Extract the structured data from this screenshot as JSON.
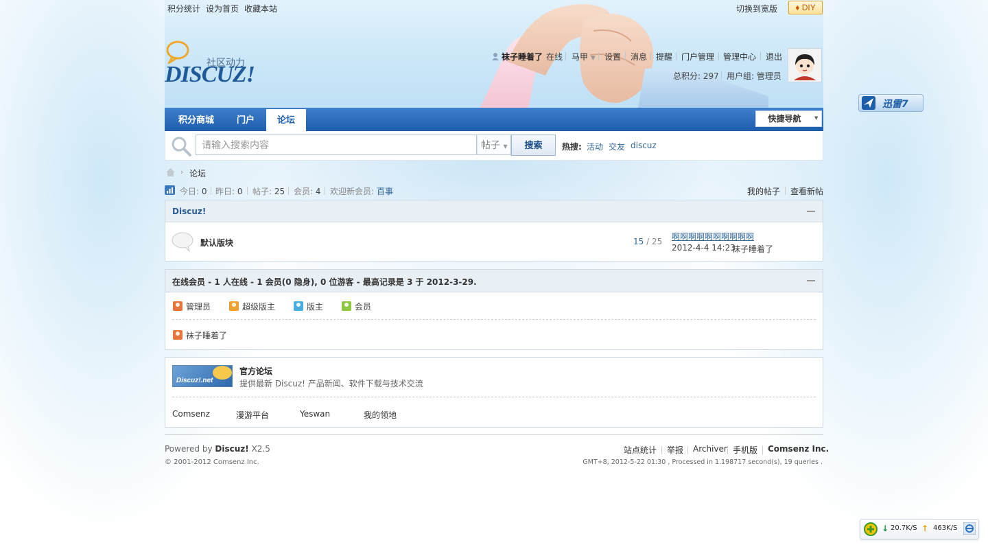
{
  "topbar": {
    "links": [
      "积分统计",
      "设为首页",
      "收藏本站"
    ],
    "wide_switch": "切换到宽版",
    "diy": "DIY"
  },
  "logo": {
    "sub": "社区动力",
    "word": "DISCUZ!"
  },
  "user": {
    "name": "袜子睡着了",
    "status": "在线",
    "vest": "马甲",
    "links": [
      "设置",
      "消息",
      "提醒",
      "门户管理",
      "管理中心",
      "退出"
    ],
    "points_label": "总积分:",
    "points": "297",
    "group_label": "用户组:",
    "group": "管理员"
  },
  "nav": {
    "items": [
      "积分商城",
      "门户",
      "论坛"
    ],
    "active_index": 2,
    "quick_nav": "快捷导航"
  },
  "search": {
    "placeholder": "请输入搜索内容",
    "type": "帖子",
    "button": "搜索",
    "hot_label": "热搜:",
    "hot": [
      "活动",
      "交友",
      "discuz"
    ]
  },
  "breadcrumb": {
    "current": "论坛"
  },
  "stats": {
    "today_label": "今日:",
    "today": "0",
    "yesterday_label": "昨日:",
    "yesterday": "0",
    "posts_label": "帖子:",
    "posts": "25",
    "members_label": "会员:",
    "members": "4",
    "welcome_label": "欢迎新会员:",
    "newest_member": "百事",
    "my_posts": "我的帖子",
    "new_posts": "查看新帖"
  },
  "category": {
    "title": "Discuz!",
    "forum_name": "默认版块",
    "threads": "15",
    "slash": "/",
    "posts": "25",
    "last_title": "啊啊啊啊啊啊啊啊啊啊",
    "last_time": "2012-4-4 14:23",
    "last_user": "袜子睡着了"
  },
  "online": {
    "title": "在线会员 - 1 人在线 - 1 会员(0 隐身), 0 位游客 - 最高记录是 3 于 2012-3-29.",
    "roles": [
      "管理员",
      "超级版主",
      "版主",
      "会员"
    ],
    "users": [
      "袜子睡着了"
    ]
  },
  "links": {
    "featured_logo": "Discuz!.net",
    "featured_name": "官方论坛",
    "featured_desc": "提供最新 Discuz! 产品新闻、软件下载与技术交流",
    "items": [
      "Comsenz",
      "漫游平台",
      "Yeswan",
      "我的领地"
    ]
  },
  "footer": {
    "powered_by": "Powered by",
    "product": "Discuz!",
    "version": "X2.5",
    "copyright": "© 2001-2012 Comsenz Inc.",
    "links": [
      "站点统计",
      "举报",
      "Archiver",
      "手机版"
    ],
    "company": "Comsenz Inc.",
    "debug": "GMT+8, 2012-5-22 01:30 , Processed in 1.198717 second(s), 19 queries ."
  },
  "widgets": {
    "thunder": "迅雷7",
    "down_speed": "20.7K/S",
    "up_speed": "463K/S"
  },
  "colors": {
    "nav_blue": "#1e5fae",
    "link_blue": "#336699",
    "box_head": "#e8eff5"
  }
}
